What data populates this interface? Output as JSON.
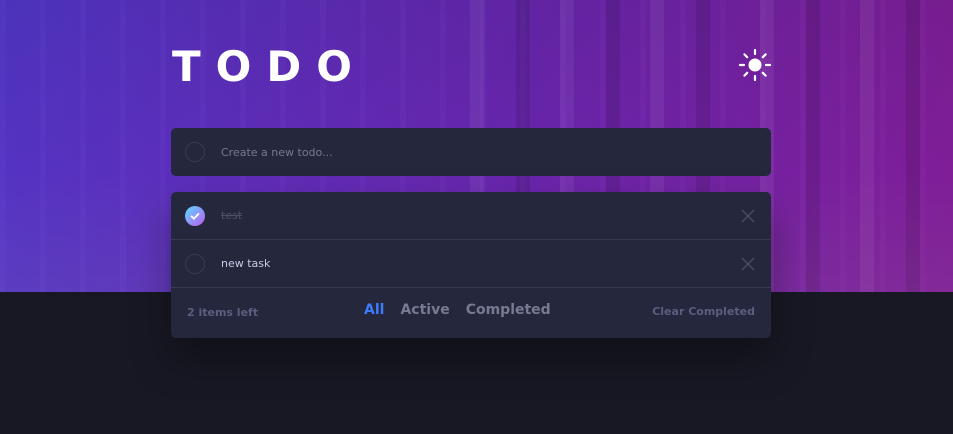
{
  "app": {
    "title": "TODO",
    "theme_icon": "sun-icon"
  },
  "new_todo": {
    "placeholder": "Create a new todo..."
  },
  "todos": [
    {
      "text": "test",
      "completed": true
    },
    {
      "text": "new task",
      "completed": false
    }
  ],
  "footer": {
    "items_left": "2 items left",
    "filters": [
      {
        "label": "All",
        "active": true
      },
      {
        "label": "Active",
        "active": false
      },
      {
        "label": "Completed",
        "active": false
      }
    ],
    "clear_label": "Clear Completed"
  },
  "colors": {
    "accent": "#3a7cfd",
    "card": "#25273c",
    "background": "#181824",
    "check_gradient_start": "#57ddff",
    "check_gradient_end": "#c058f3"
  }
}
